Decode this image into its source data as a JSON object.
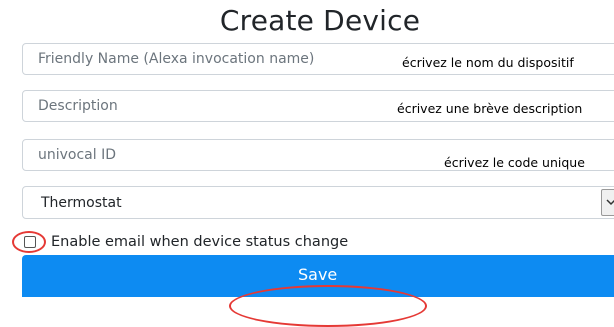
{
  "form": {
    "title": "Create Device",
    "friendly_name": {
      "placeholder": "Friendly Name (Alexa invocation name)",
      "note": "écrivez le nom du dispositif"
    },
    "description": {
      "placeholder": "Description",
      "note": "écrivez une brève description"
    },
    "univocal_id": {
      "placeholder": "univocal ID",
      "note": "écrivez le code unique"
    },
    "device_type": {
      "selected": "Thermostat"
    },
    "email_option": {
      "label": "Enable email when device status change",
      "checked": false
    },
    "save_label": "Save"
  },
  "colors": {
    "primary": "#0d8bf2",
    "highlight": "#e53935",
    "border": "#ced4da"
  },
  "icons": {
    "select_arrow": "chevron-down-icon"
  }
}
